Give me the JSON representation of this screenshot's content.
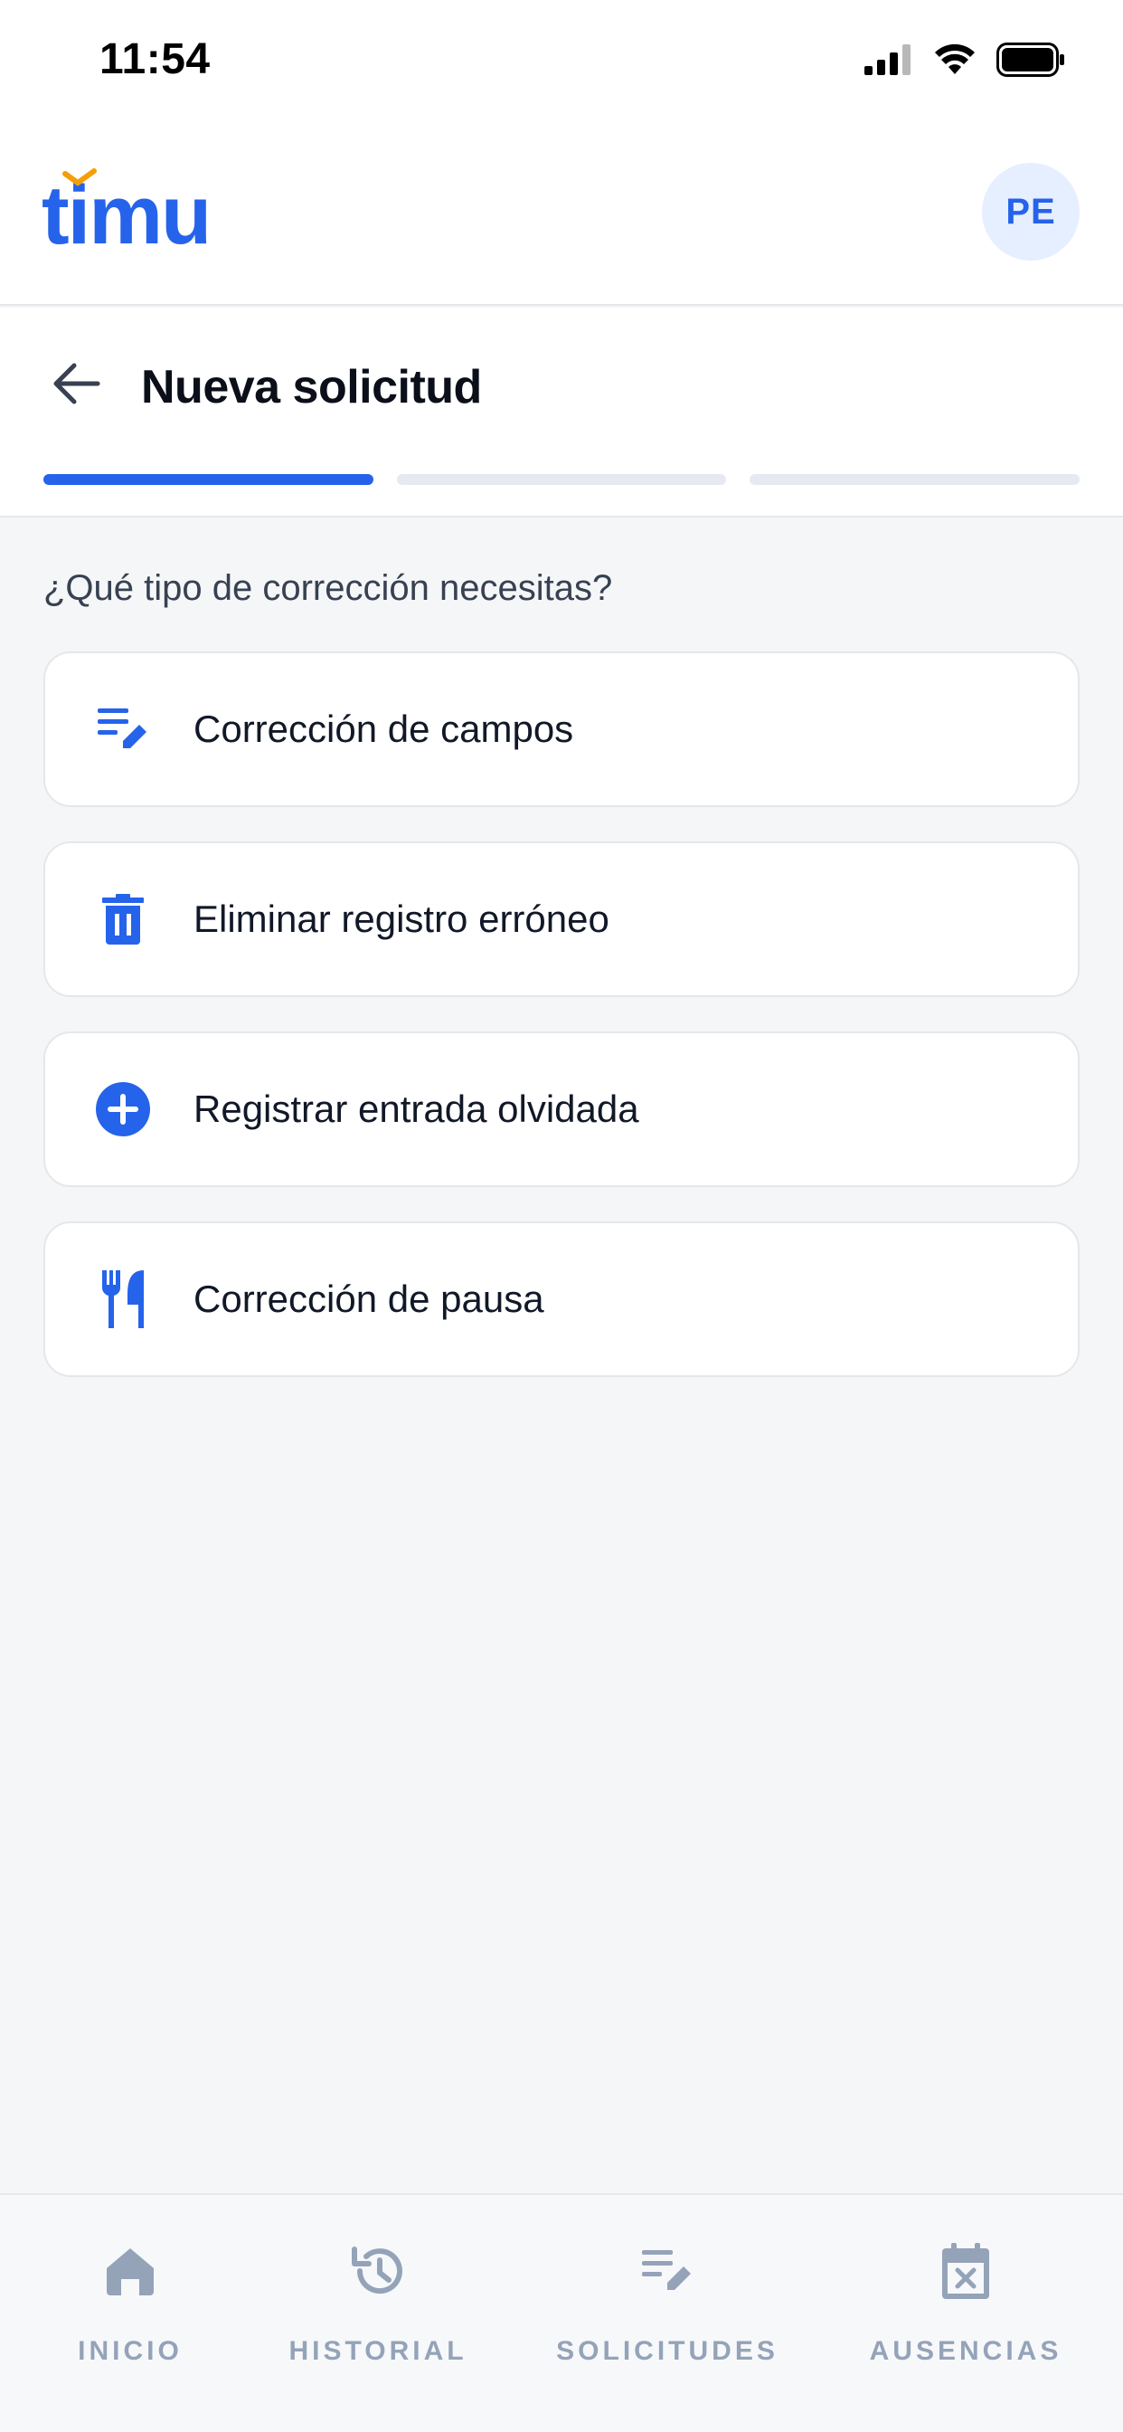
{
  "status_bar": {
    "time": "11:54"
  },
  "header": {
    "logo_text": "timu",
    "avatar_initials": "PE"
  },
  "subheader": {
    "title": "Nueva solicitud",
    "steps_total": 3,
    "current_step": 1
  },
  "content": {
    "question": "¿Qué tipo de corrección necesitas?",
    "options": [
      {
        "label": "Corrección de campos",
        "icon": "edit-list-icon"
      },
      {
        "label": "Eliminar registro erróneo",
        "icon": "trash-icon"
      },
      {
        "label": "Registrar entrada olvidada",
        "icon": "add-circle-icon"
      },
      {
        "label": "Corrección de pausa",
        "icon": "fork-knife-icon"
      }
    ]
  },
  "bottom_nav": {
    "items": [
      {
        "label": "INICIO",
        "icon": "home-icon"
      },
      {
        "label": "HISTORIAL",
        "icon": "history-icon"
      },
      {
        "label": "SOLICITUDES",
        "icon": "edit-list-icon"
      },
      {
        "label": "AUSENCIAS",
        "icon": "calendar-x-icon"
      }
    ]
  },
  "colors": {
    "primary": "#2563eb",
    "inactive": "#94a3b8",
    "accent": "#f59e0b"
  }
}
